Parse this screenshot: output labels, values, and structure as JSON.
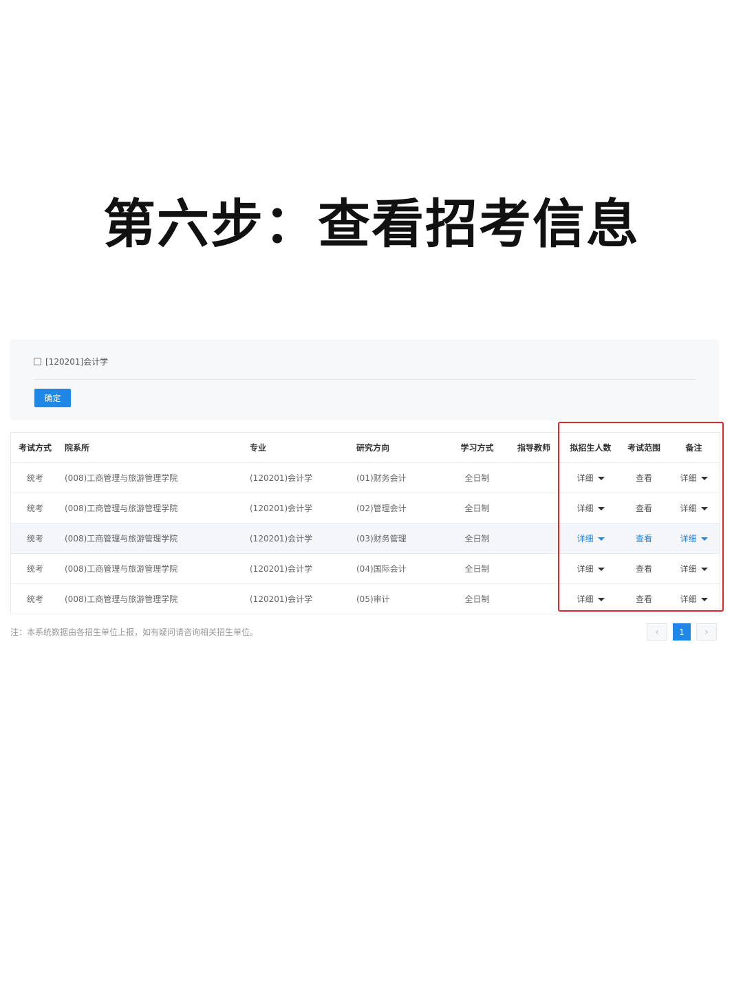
{
  "headline": "第六步：查看招考信息",
  "filter": {
    "option_label": "[120201]会计学",
    "confirm_label": "确定"
  },
  "table": {
    "headers": {
      "exam_mode": "考试方式",
      "department": "院系所",
      "major": "专业",
      "research_direction": "研究方向",
      "study_mode": "学习方式",
      "advisor": "指导教师",
      "planned_enrollment": "拟招生人数",
      "exam_scope": "考试范围",
      "remarks": "备注"
    },
    "rows": [
      {
        "exam_mode": "统考",
        "department": "(008)工商管理与旅游管理学院",
        "major": "(120201)会计学",
        "research_direction": "(01)财务会计",
        "study_mode": "全日制",
        "advisor": "",
        "planned_enrollment": "详细",
        "exam_scope": "查看",
        "remarks": "详细"
      },
      {
        "exam_mode": "统考",
        "department": "(008)工商管理与旅游管理学院",
        "major": "(120201)会计学",
        "research_direction": "(02)管理会计",
        "study_mode": "全日制",
        "advisor": "",
        "planned_enrollment": "详细",
        "exam_scope": "查看",
        "remarks": "详细"
      },
      {
        "exam_mode": "统考",
        "department": "(008)工商管理与旅游管理学院",
        "major": "(120201)会计学",
        "research_direction": "(03)财务管理",
        "study_mode": "全日制",
        "advisor": "",
        "planned_enrollment": "详细",
        "exam_scope": "查看",
        "remarks": "详细"
      },
      {
        "exam_mode": "统考",
        "department": "(008)工商管理与旅游管理学院",
        "major": "(120201)会计学",
        "research_direction": "(04)国际会计",
        "study_mode": "全日制",
        "advisor": "",
        "planned_enrollment": "详细",
        "exam_scope": "查看",
        "remarks": "详细"
      },
      {
        "exam_mode": "统考",
        "department": "(008)工商管理与旅游管理学院",
        "major": "(120201)会计学",
        "research_direction": "(05)审计",
        "study_mode": "全日制",
        "advisor": "",
        "planned_enrollment": "详细",
        "exam_scope": "查看",
        "remarks": "详细"
      }
    ]
  },
  "note": "注：本系统数据由各招生单位上报，如有疑问请咨询相关招生单位。",
  "pagination": {
    "prev_icon": "chevron-left-icon",
    "prev_glyph": "‹",
    "current_page": "1",
    "next_icon": "chevron-right-icon",
    "next_glyph": "›"
  },
  "colors": {
    "accent": "#1f87e5",
    "highlight_border": "#e0262b"
  }
}
